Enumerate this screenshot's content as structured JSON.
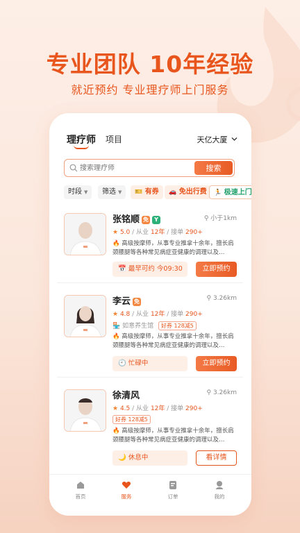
{
  "hero": {
    "title": "专业团队 10年经验",
    "subtitle": "就近预约 专业理疗师上门服务"
  },
  "header": {
    "tab_active": "理疗师",
    "tab_other": "项目",
    "location": "天亿大厦",
    "location_icon": "chevron-down-icon"
  },
  "search": {
    "placeholder": "搜索理疗师",
    "button": "搜索"
  },
  "filters": {
    "time": "时段",
    "filter": "筛选",
    "coupon": "有券",
    "free_fare": "免出行费",
    "fast": "极速上门"
  },
  "therapists": [
    {
      "name": "张铭顺",
      "badges": [
        "免",
        "Y"
      ],
      "distance": "小于1km",
      "rating": "5.0",
      "years_label": "从业",
      "years": "12年",
      "orders_label": "接单",
      "orders": "290+",
      "desc": "高级按摩师，从事专业推拿十余年，擅长肩颈腰腿等各种常见病症亚健康的调理以及…",
      "status_prefix": "最早可约",
      "status_time": "今09:30",
      "button": "立即预约"
    },
    {
      "name": "李云",
      "badges": [
        "免"
      ],
      "distance": "3.26km",
      "rating": "4.8",
      "years_label": "从业",
      "years": "12年",
      "orders_label": "接单",
      "orders": "290+",
      "shop": "如意养生馆",
      "coupon": "好券 128减5",
      "desc": "高级按摩师，从事专业推拿十余年，擅长肩颈腰腿等各种常见病症亚健康的调理以及…",
      "status_prefix": "忙碌中",
      "button": "立即预约"
    },
    {
      "name": "徐清风",
      "badges": [],
      "distance": "3.26km",
      "rating": "4.5",
      "years_label": "从业",
      "years": "12年",
      "orders_label": "接单",
      "orders": "290+",
      "coupon": "好券 128减5",
      "desc": "高级按摩师，从事专业推拿十余年，擅长肩颈腰腿等各种常见病症亚健康的调理以及…",
      "status_prefix": "休息中",
      "button": "看详情"
    }
  ],
  "tabbar": {
    "home": "首页",
    "service": "服务",
    "orders": "订单",
    "mine": "我的"
  },
  "colors": {
    "accent": "#e8561e",
    "green": "#21a06a"
  }
}
